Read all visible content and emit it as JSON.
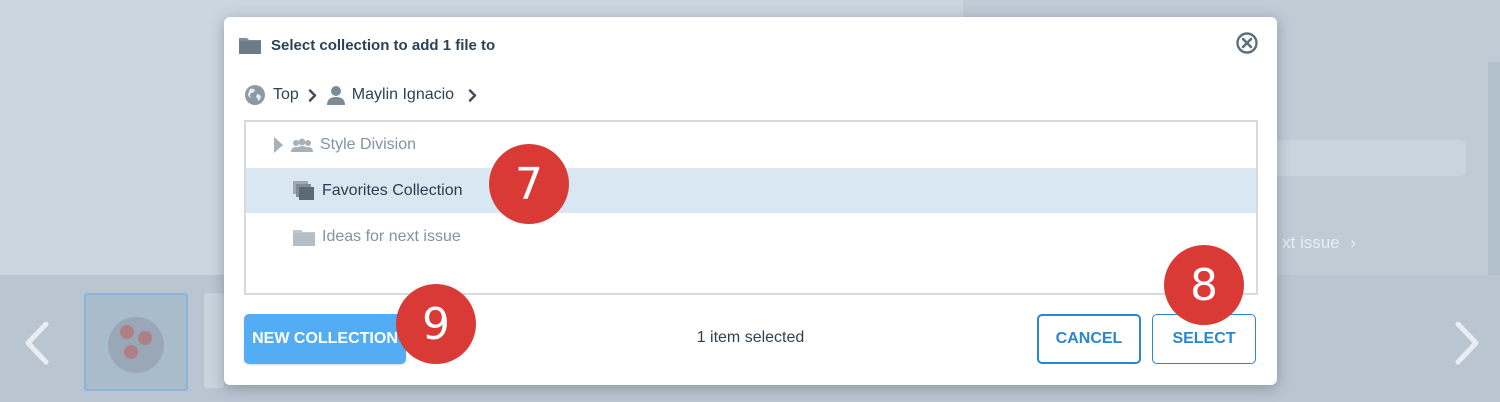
{
  "dialog": {
    "title": "Select collection to add 1 file to",
    "breadcrumb": [
      {
        "label": "Top",
        "icon": "globe-icon"
      },
      {
        "label": "Maylin Ignacio",
        "icon": "user-icon"
      }
    ],
    "tree": [
      {
        "label": "Style Division",
        "icon": "group-icon",
        "state": "collapsed"
      },
      {
        "label": "Favorites Collection",
        "icon": "collection-icon",
        "selected": true
      },
      {
        "label": "Ideas for next issue",
        "icon": "folder-icon"
      }
    ],
    "status": "1 item selected",
    "buttons": {
      "new_collection": "NEW COLLECTION",
      "cancel": "CANCEL",
      "select": "SELECT"
    }
  },
  "callouts": [
    "7",
    "8",
    "9"
  ],
  "background": {
    "breadcrumb_fragment": "xt issue"
  },
  "colors": {
    "accent": "#2b86cf",
    "primary_button": "#53adf5",
    "selected_row": "#d8e7f2",
    "callout": "#d93a35"
  }
}
